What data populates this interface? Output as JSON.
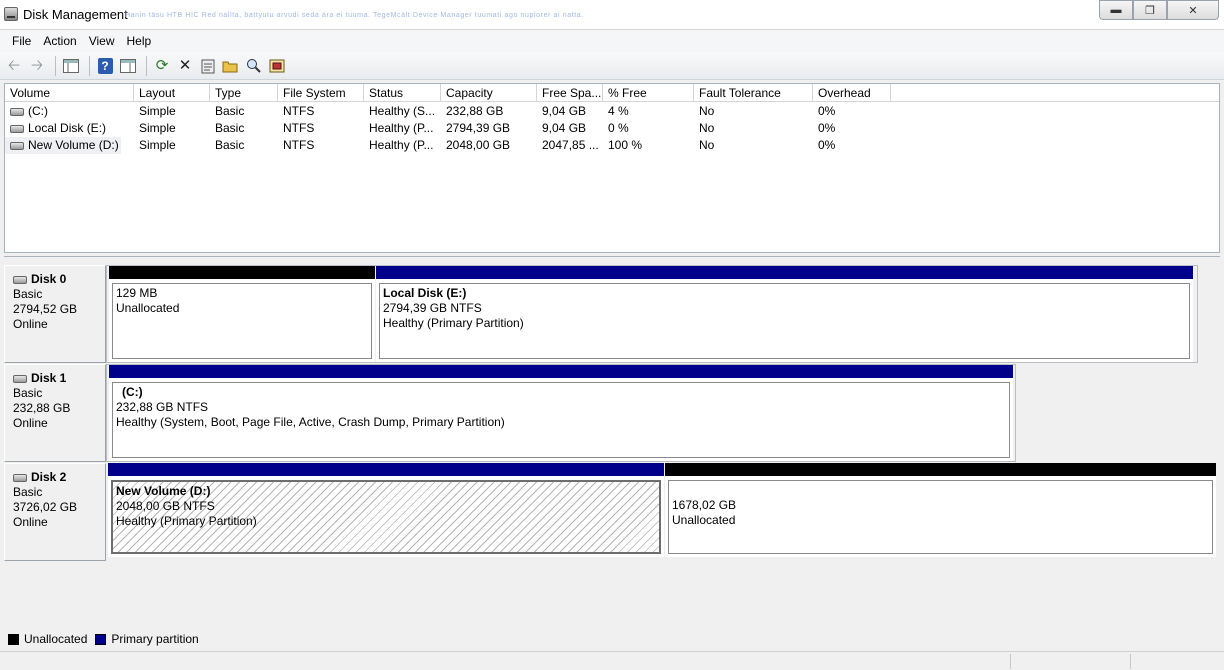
{
  "window": {
    "title": "Disk Management",
    "faded_caption": "Hanin täsu HTB HIC Red nallta, battyutu arvudi seda ára ei tuuma. TegeMcält Device Manager tuumati ago nuplorer ai natta."
  },
  "menu": [
    "File",
    "Action",
    "View",
    "Help"
  ],
  "toolbar_icons": [
    "back-arrow-icon",
    "forward-arrow-icon",
    "console-tree-icon",
    "help-icon",
    "properties-pane-icon",
    "refresh-icon",
    "delete-icon",
    "properties-icon",
    "open-folder-icon",
    "search-icon",
    "disk-settings-icon"
  ],
  "volume_list": {
    "columns": [
      "Volume",
      "Layout",
      "Type",
      "File System",
      "Status",
      "Capacity",
      "Free Spa...",
      "% Free",
      "Fault Tolerance",
      "Overhead"
    ],
    "rows": [
      [
        "(C:)",
        "Simple",
        "Basic",
        "NTFS",
        "Healthy (S...",
        "232,88 GB",
        "9,04 GB",
        "4 %",
        "No",
        "0%"
      ],
      [
        "Local Disk (E:)",
        "Simple",
        "Basic",
        "NTFS",
        "Healthy (P...",
        "2794,39 GB",
        "9,04 GB",
        "0 %",
        "No",
        "0%"
      ],
      [
        "New Volume (D:)",
        "Simple",
        "Basic",
        "NTFS",
        "Healthy (P...",
        "2048,00 GB",
        "2047,85 ...",
        "100 %",
        "No",
        "0%"
      ]
    ]
  },
  "disks": [
    {
      "name": "Disk 0",
      "type": "Basic",
      "size": "2794,52 GB",
      "status": "Online",
      "partitions": [
        {
          "kind": "unallocated",
          "name": "",
          "size": "129 MB",
          "detail": "Unallocated"
        },
        {
          "kind": "primary",
          "name": "Local Disk  (E:)",
          "size": "2794,39 GB NTFS",
          "detail": "Healthy (Primary Partition)"
        }
      ]
    },
    {
      "name": "Disk 1",
      "type": "Basic",
      "size": "232,88 GB",
      "status": "Online",
      "partitions": [
        {
          "kind": "primary",
          "name": "(C:)",
          "size": "232,88 GB NTFS",
          "detail": "Healthy (System, Boot, Page File, Active, Crash Dump, Primary Partition)"
        }
      ]
    },
    {
      "name": "Disk 2",
      "type": "Basic",
      "size": "3726,02 GB",
      "status": "Online",
      "partitions": [
        {
          "kind": "primary",
          "name": "New Volume  (D:)",
          "size": "2048,00 GB NTFS",
          "detail": "Healthy (Primary Partition)",
          "selected": true
        },
        {
          "kind": "unallocated",
          "name": "",
          "size": "1678,02 GB",
          "detail": "Unallocated"
        }
      ]
    }
  ],
  "legend": [
    {
      "label": "Unallocated",
      "color": "#000000"
    },
    {
      "label": "Primary partition",
      "color": "#00008b"
    }
  ]
}
